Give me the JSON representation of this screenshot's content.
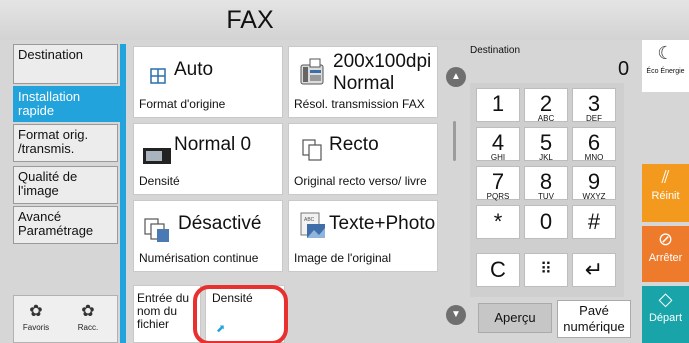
{
  "title": "FAX",
  "tabs": [
    {
      "label": "Destination"
    },
    {
      "label": "Installation rapide"
    },
    {
      "label": "Format orig. /transmis."
    },
    {
      "label": "Qualité de l'image"
    },
    {
      "label": "Avancé Paramétrage"
    }
  ],
  "shortcuts": {
    "favorites": "Favoris",
    "shortcut": "Racc."
  },
  "tiles": {
    "orig_format": {
      "value": "Auto",
      "label": "Format d'origine"
    },
    "resolution": {
      "value": "200x100dpi Normal",
      "label": "Résol. transmission FAX"
    },
    "density": {
      "value": "Normal 0",
      "label": "Densité"
    },
    "duplex": {
      "value": "Recto",
      "label": "Original recto verso/ livre"
    },
    "continuous": {
      "value": "Désactivé",
      "label": "Numérisation continue"
    },
    "image": {
      "value": "Texte+Photo",
      "label": "Image de l'original"
    }
  },
  "bottom_tiles": {
    "file_name": "Entrée du nom du fichier",
    "density": "Densité"
  },
  "destination": {
    "label": "Destination",
    "count": "0"
  },
  "keypad": [
    {
      "n": "1",
      "s": ""
    },
    {
      "n": "2",
      "s": "ABC"
    },
    {
      "n": "3",
      "s": "DEF"
    },
    {
      "n": "4",
      "s": "GHI"
    },
    {
      "n": "5",
      "s": "JKL"
    },
    {
      "n": "6",
      "s": "MNO"
    },
    {
      "n": "7",
      "s": "PQRS"
    },
    {
      "n": "8",
      "s": "TUV"
    },
    {
      "n": "9",
      "s": "WXYZ"
    },
    {
      "n": "*",
      "s": ""
    },
    {
      "n": "0",
      "s": ""
    },
    {
      "n": "#",
      "s": ""
    }
  ],
  "keypad_extra": {
    "clear": "C",
    "grid": "⠿",
    "enter": "↵"
  },
  "buttons": {
    "preview": "Aperçu",
    "numpad": "Pavé numérique"
  },
  "side": {
    "eco": "Éco Énergie",
    "reset": "Réinit",
    "stop": "Arrêter",
    "start": "Départ"
  },
  "colors": {
    "accent": "#22a3db",
    "reset": "#f39a1e",
    "start": "#19a4aa",
    "highlight": "#e8302f"
  }
}
